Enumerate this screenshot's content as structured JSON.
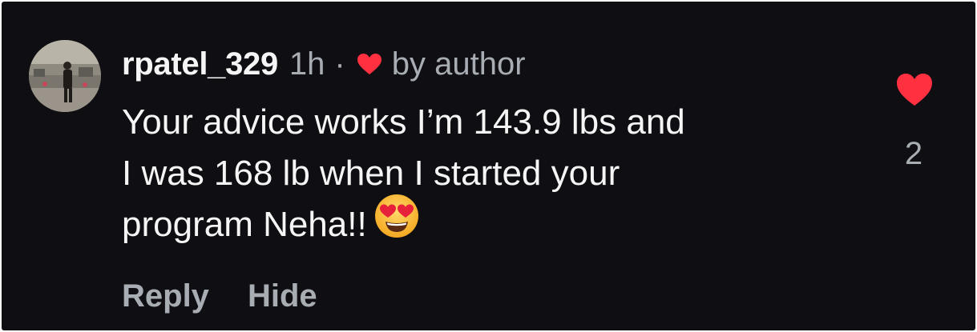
{
  "comment": {
    "username": "rpatel_329",
    "time": "1h",
    "separator": "·",
    "liked_by_author_label": "by author",
    "text_lines": [
      "Your advice works I’m 143.9 lbs and",
      "I was 168 lb when I started your",
      "program Neha!!"
    ],
    "emoji": "smiling-face-with-heart-eyes",
    "actions": {
      "reply_label": "Reply",
      "hide_label": "Hide"
    },
    "likes": {
      "count": "2",
      "liked": true
    }
  },
  "colors": {
    "background": "#0f0f13",
    "primary_text": "#f5f5f5",
    "secondary_text": "#a8acb3",
    "like_red": "#ff3040"
  },
  "icons": {
    "author_heart": "heart-icon",
    "like": "heart-filled-icon"
  }
}
